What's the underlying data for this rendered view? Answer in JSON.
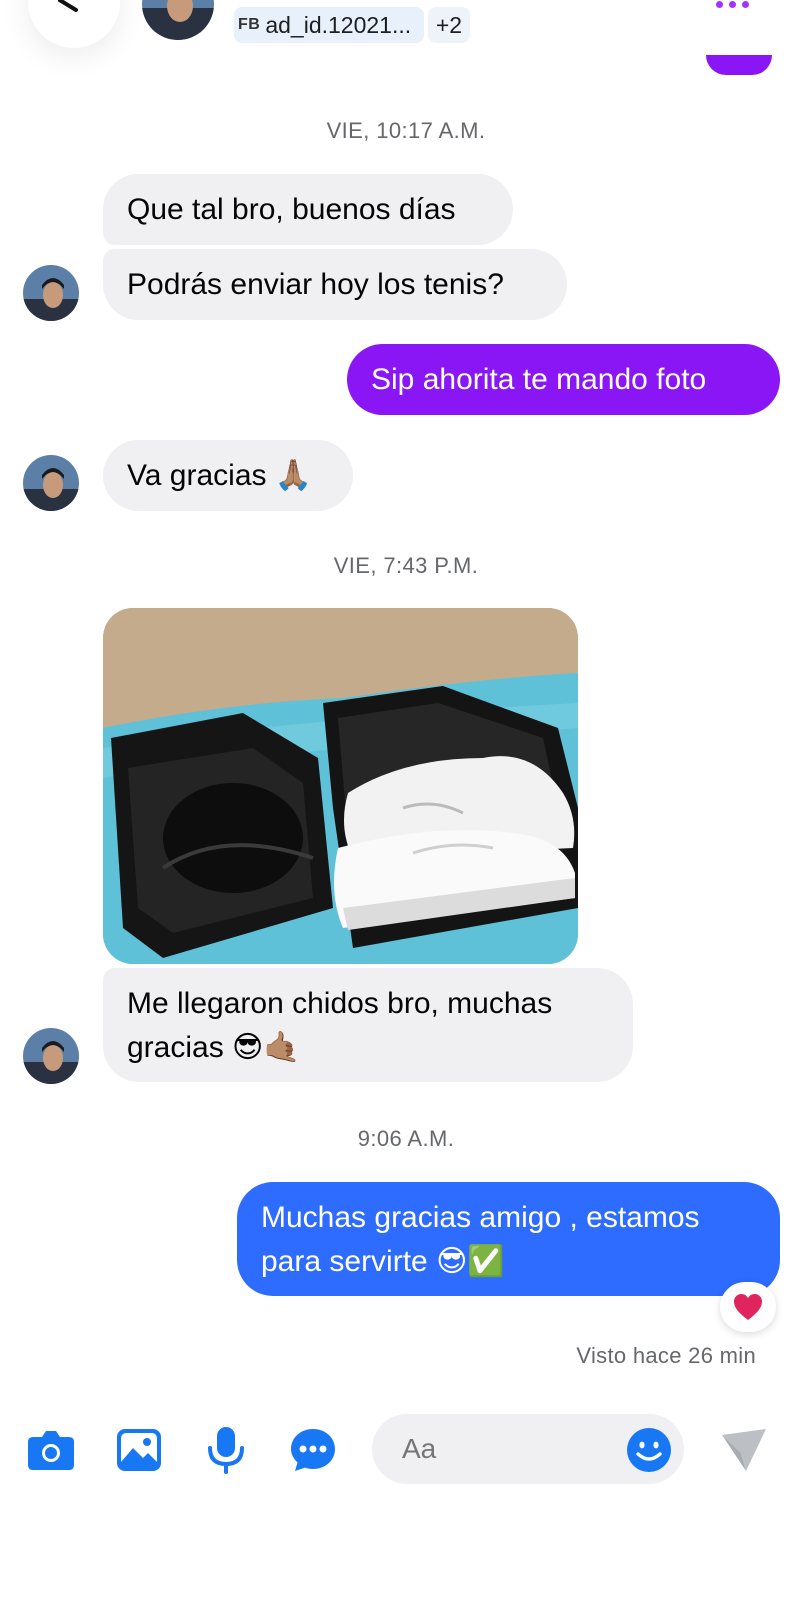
{
  "header": {
    "tag_prefix": "FB",
    "ad_tag": "ad_id.12021...",
    "extra_tags": "+2"
  },
  "timestamps": {
    "t1": "VIE, 10:17 A.M.",
    "t2": "VIE, 7:43 P.M.",
    "t3": "9:06 A.M."
  },
  "messages": [
    {
      "from": "them",
      "text": "Que tal bro, buenos días"
    },
    {
      "from": "them",
      "text": "Podrás enviar hoy los tenis?"
    },
    {
      "from": "me",
      "text": "Sip ahorita te mando foto"
    },
    {
      "from": "them",
      "text": "Va gracias 🙏🏽"
    },
    {
      "from": "them",
      "text_line1": "Me llegaron chidos bro, muchas",
      "text_line2": "gracias 😎🤙🏽"
    },
    {
      "from": "me",
      "text_line1": "Muchas gracias amigo , estamos",
      "text_line2": "para servirte 😎✅"
    }
  ],
  "reaction": "❤️",
  "seen_status": "Visto hace 26 min",
  "composer": {
    "placeholder": "Aa"
  },
  "colors": {
    "outgoing_purple": "#8a15f5",
    "outgoing_blue": "#2e6bff",
    "incoming_bg": "#f0f0f2",
    "accent_blue": "#1877f2",
    "timestamp_gray": "#65676b"
  },
  "icons": [
    "back-arrow-icon",
    "more-options-icon",
    "camera-icon",
    "gallery-icon",
    "microphone-icon",
    "chat-options-icon",
    "emoji-icon",
    "send-icon",
    "heart-icon"
  ]
}
